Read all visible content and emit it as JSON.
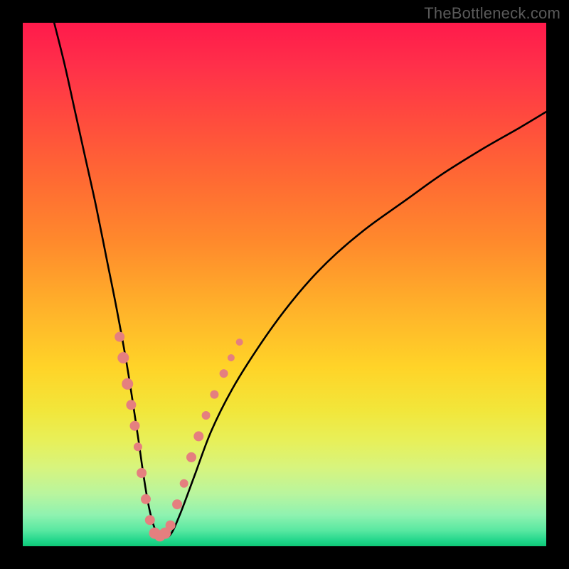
{
  "watermark": "TheBottleneck.com",
  "colors": {
    "background": "#000000",
    "curve": "#000000",
    "markers": "#e57f7f",
    "gradient_top": "#ff1a4b",
    "gradient_bottom": "#0fc776"
  },
  "chart_data": {
    "type": "line",
    "title": "",
    "xlabel": "",
    "ylabel": "",
    "xlim": [
      0,
      100
    ],
    "ylim": [
      0,
      100
    ],
    "grid": false,
    "series": [
      {
        "name": "bottleneck-curve",
        "x": [
          6,
          8,
          10,
          12,
          14,
          16,
          18,
          20,
          22,
          23,
          24,
          25,
          26,
          28,
          30,
          33,
          36,
          40,
          45,
          50,
          55,
          60,
          66,
          73,
          80,
          88,
          95,
          100
        ],
        "y": [
          100,
          92,
          83,
          74,
          65,
          55,
          45,
          34,
          21,
          14,
          8,
          4,
          2,
          2,
          6,
          14,
          22,
          30,
          38,
          45,
          51,
          56,
          61,
          66,
          71,
          76,
          80,
          83
        ]
      }
    ],
    "markers": [
      {
        "x": 18.5,
        "y": 40,
        "r": 7
      },
      {
        "x": 19.2,
        "y": 36,
        "r": 8
      },
      {
        "x": 20.0,
        "y": 31,
        "r": 8
      },
      {
        "x": 20.7,
        "y": 27,
        "r": 7
      },
      {
        "x": 21.4,
        "y": 23,
        "r": 7
      },
      {
        "x": 22.0,
        "y": 19,
        "r": 6
      },
      {
        "x": 22.7,
        "y": 14,
        "r": 7
      },
      {
        "x": 23.5,
        "y": 9,
        "r": 7
      },
      {
        "x": 24.3,
        "y": 5,
        "r": 7
      },
      {
        "x": 25.2,
        "y": 2.5,
        "r": 8
      },
      {
        "x": 26.2,
        "y": 2,
        "r": 8
      },
      {
        "x": 27.2,
        "y": 2.5,
        "r": 8
      },
      {
        "x": 28.2,
        "y": 4,
        "r": 7
      },
      {
        "x": 29.5,
        "y": 8,
        "r": 7
      },
      {
        "x": 30.8,
        "y": 12,
        "r": 6
      },
      {
        "x": 32.2,
        "y": 17,
        "r": 7
      },
      {
        "x": 33.6,
        "y": 21,
        "r": 7
      },
      {
        "x": 35.0,
        "y": 25,
        "r": 6
      },
      {
        "x": 36.6,
        "y": 29,
        "r": 6
      },
      {
        "x": 38.4,
        "y": 33,
        "r": 6
      },
      {
        "x": 39.8,
        "y": 36,
        "r": 5
      },
      {
        "x": 41.4,
        "y": 39,
        "r": 5
      }
    ]
  }
}
